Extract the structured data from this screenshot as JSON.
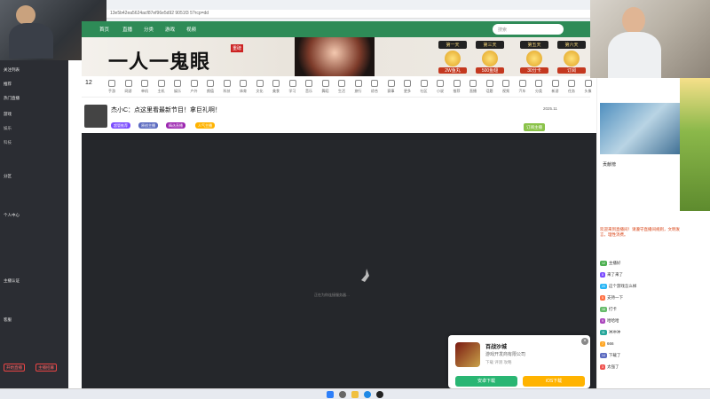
{
  "browser": {
    "url": "13e5b42ea5624acf87ef96e5d92 9051f3 5?rcp=dd"
  },
  "site_nav": {
    "links": [
      "首页",
      "直播",
      "分类",
      "游戏",
      "视频"
    ],
    "search_placeholder": "搜索"
  },
  "banner": {
    "title": "一人一鬼眼",
    "tag": "重磅",
    "rewards": [
      {
        "label": "第一天",
        "value": "2W鱼丸"
      },
      {
        "label": "第三天",
        "value": "500鱼翅"
      },
      {
        "label": "第五天",
        "value": "30分卡"
      },
      {
        "label": "第六天",
        "value": "订阅"
      }
    ]
  },
  "categories": {
    "current_count": "12",
    "items": [
      "手游",
      "网游",
      "单机",
      "主机",
      "娱乐",
      "户外",
      "颜值",
      "科技",
      "体育",
      "文化",
      "美食",
      "学习",
      "音乐",
      "舞蹈",
      "生活",
      "旅行",
      "综合",
      "赛事",
      "更多",
      "社区",
      "小说",
      "推荐",
      "直播",
      "话题",
      "视频",
      "汽车",
      "分类",
      "新游",
      "任务",
      "头像"
    ]
  },
  "streamer": {
    "title": "杰小C：点这里看最新节目！拿巨礼啊！",
    "meta": "2025.11",
    "tags": [
      "超管推荐",
      "原创主播",
      "精选直播",
      "人气主播"
    ],
    "follow_label": "订阅主播"
  },
  "player": {
    "loading_text": "正在为你连接服务器…"
  },
  "sidebar": {
    "items": [
      "关注列表",
      "推荐",
      "热门直播",
      "游戏",
      "娱乐",
      "科技",
      "分区",
      "个人中心",
      "主播认证",
      "客服"
    ],
    "buttons": [
      "开始直播",
      "主播招募"
    ]
  },
  "popup": {
    "title": "百战沙城",
    "subtitle": "游戏开发商有限公司",
    "meta": "下载  评测  攻略",
    "btn_android": "安卓下载",
    "btn_ios": "iOS下载"
  },
  "chat": {
    "rank_label": "贡献榜",
    "notice": "欢迎来到直播间！请遵守直播间规则，文明发言，理性消费。",
    "messages": [
      {
        "badge": "12",
        "text": "主播好"
      },
      {
        "badge": "8",
        "text": "来了来了"
      },
      {
        "badge": "20",
        "text": "这个游戏怎么样"
      },
      {
        "badge": "5",
        "text": "支持一下"
      },
      {
        "badge": "16",
        "text": "打卡"
      },
      {
        "badge": "9",
        "text": "哈哈哈"
      },
      {
        "badge": "11",
        "text": "冲冲冲"
      },
      {
        "badge": "7",
        "text": "666"
      },
      {
        "badge": "14",
        "text": "下载了"
      },
      {
        "badge": "3",
        "text": "太强了"
      }
    ]
  },
  "colors": {
    "accent_green": "#2e8b57",
    "accent_red": "#e44",
    "player_bg": "#25272b",
    "sidebar_bg": "#2b2d33"
  }
}
